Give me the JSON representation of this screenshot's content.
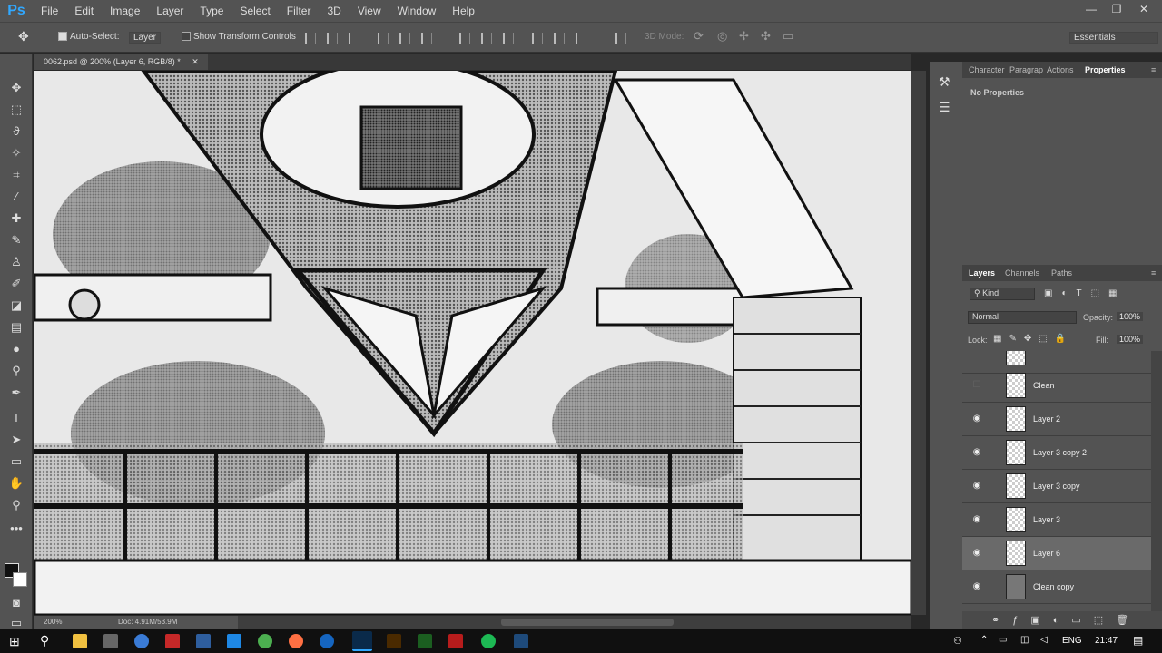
{
  "app": {
    "logo": "Ps",
    "menus": [
      "File",
      "Edit",
      "Image",
      "Layer",
      "Type",
      "Select",
      "Filter",
      "3D",
      "View",
      "Window",
      "Help"
    ]
  },
  "options": {
    "auto_select_label": "Auto-Select:",
    "auto_select_value": "Layer",
    "show_transform_label": "Show Transform Controls",
    "mode_3d_label": "3D Mode:",
    "workspace": "Essentials"
  },
  "document": {
    "tab_title": "0062.psd @ 200% (Layer 6, RGB/8) *",
    "zoom": "200%",
    "doc_size": "Doc: 4.91M/53.9M"
  },
  "properties": {
    "tabs": [
      "Character",
      "Paragrap",
      "Actions",
      "Properties"
    ],
    "message": "No Properties"
  },
  "layers": {
    "tabs": [
      "Layers",
      "Channels",
      "Paths"
    ],
    "filter": "Kind",
    "blend_mode": "Normal",
    "opacity_label": "Opacity:",
    "opacity": "100%",
    "lock_label": "Lock:",
    "fill_label": "Fill:",
    "fill": "100%",
    "items": [
      {
        "name": "Clean",
        "visible": false
      },
      {
        "name": "Layer 2",
        "visible": true
      },
      {
        "name": "Layer 3 copy 2",
        "visible": true
      },
      {
        "name": "Layer 3 copy",
        "visible": true
      },
      {
        "name": "Layer 3",
        "visible": true
      },
      {
        "name": "Layer 6",
        "visible": true,
        "selected": true
      },
      {
        "name": "Clean copy",
        "visible": true
      }
    ]
  },
  "taskbar": {
    "lang": "ENG",
    "time": "21:47"
  }
}
